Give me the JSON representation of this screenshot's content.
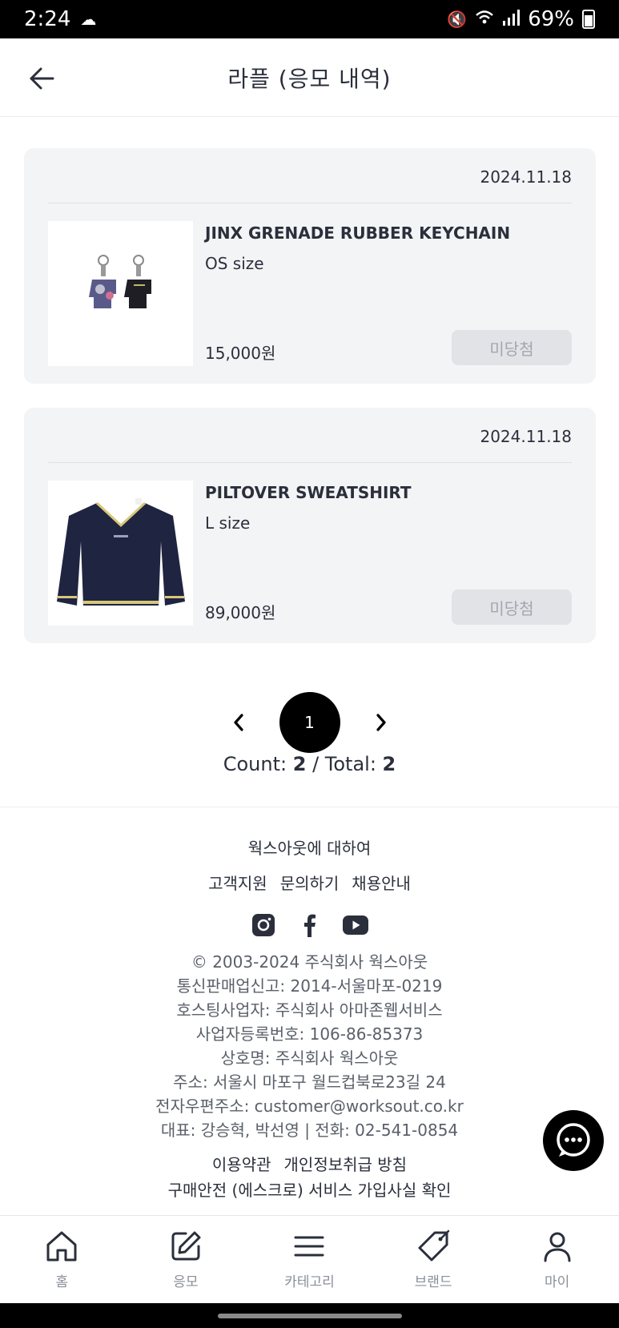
{
  "status_bar": {
    "time": "2:24",
    "battery": "69%"
  },
  "header": {
    "title": "라플 (응모 내역)"
  },
  "entries": [
    {
      "date": "2024.11.18",
      "name": "JINX GRENADE RUBBER KEYCHAIN",
      "size": "OS size",
      "price": "15,000원",
      "status": "미당첨"
    },
    {
      "date": "2024.11.18",
      "name": "PILTOVER SWEATSHIRT",
      "size": "L size",
      "price": "89,000원",
      "status": "미당첨"
    }
  ],
  "pagination": {
    "current_page": "1",
    "count_label": "Count: ",
    "count": "2",
    "separator": " / Total: ",
    "total": "2"
  },
  "footer": {
    "about": "웍스아웃에 대하여",
    "links": [
      "고객지원",
      "문의하기",
      "채용안내"
    ],
    "info": [
      "© 2003-2024 주식회사 웍스아웃",
      "통신판매업신고: 2014-서울마포-0219",
      "호스팅사업자: 주식회사 아마존웹서비스",
      "사업자등록번호: 106-86-85373",
      "상호명: 주식회사 웍스아웃",
      "주소: 서울시 마포구 월드컵북로23길 24",
      "전자우편주소: customer@worksout.co.kr",
      "대표: 강승혁, 박선영 | 전화: 02-541-0854"
    ],
    "policy_links": [
      "이용약관",
      "개인정보취급 방침"
    ],
    "escrow": "구매안전 (에스크로) 서비스 가입사실 확인"
  },
  "bottom_nav": [
    {
      "label": "홈",
      "icon": "home-icon"
    },
    {
      "label": "응모",
      "icon": "edit-icon"
    },
    {
      "label": "카테고리",
      "icon": "menu-icon"
    },
    {
      "label": "브랜드",
      "icon": "tag-icon"
    },
    {
      "label": "마이",
      "icon": "user-icon"
    }
  ]
}
